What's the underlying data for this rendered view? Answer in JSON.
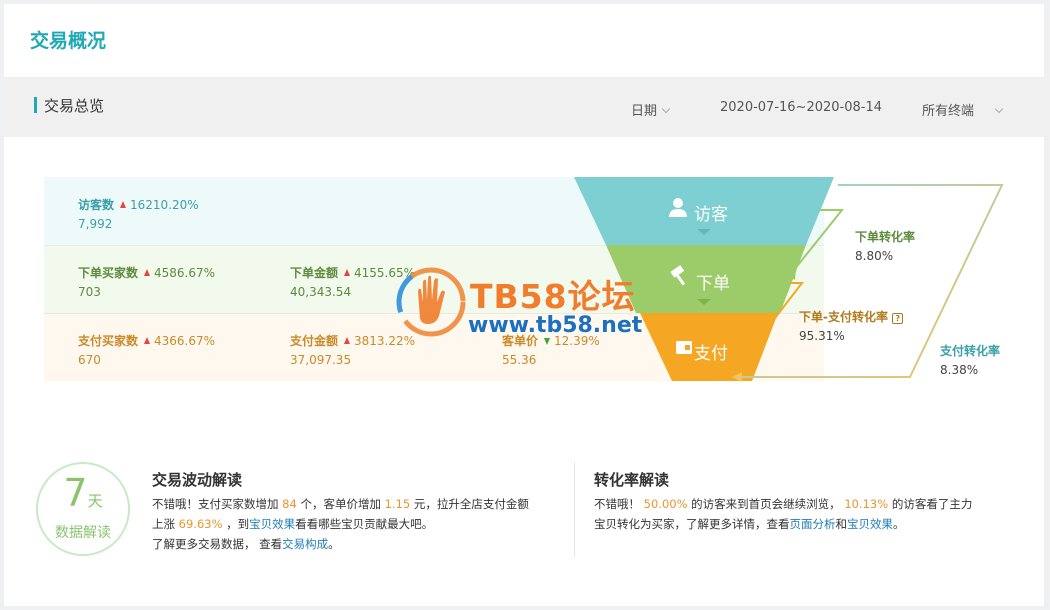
{
  "header": {
    "title": "交易概况"
  },
  "subheader": {
    "title": "交易总览",
    "filters": [
      {
        "label": "日期",
        "has_dropdown": true
      },
      {
        "label": "2020-07-16~2020-08-14",
        "has_dropdown": false
      },
      {
        "label": "所有终端",
        "has_dropdown": true
      }
    ]
  },
  "metrics": {
    "visitors": {
      "label": "访客数",
      "pct": "16210.20%",
      "trend": "up",
      "value": "7,992"
    },
    "order_buyers": {
      "label": "下单买家数",
      "pct": "4586.67%",
      "trend": "up",
      "value": "703"
    },
    "order_amount": {
      "label": "下单金额",
      "pct": "4155.65%",
      "trend": "up",
      "value": "40,343.54"
    },
    "pay_buyers": {
      "label": "支付买家数",
      "pct": "4366.67%",
      "trend": "up",
      "value": "670"
    },
    "pay_amount": {
      "label": "支付金额",
      "pct": "3813.22%",
      "trend": "up",
      "value": "37,097.35"
    },
    "unit_price": {
      "label": "客单价",
      "pct": "12.39%",
      "trend": "down",
      "value": "55.36"
    }
  },
  "funnel": {
    "stages": [
      {
        "label": "访客",
        "icon": "person-icon",
        "color": "#7dcfd2"
      },
      {
        "label": "下单",
        "icon": "gavel-icon",
        "color": "#9ccc6a"
      },
      {
        "label": "支付",
        "icon": "wallet-icon",
        "color": "#f5a623"
      }
    ],
    "conversions": {
      "order_rate": {
        "label": "下单转化率",
        "value": "8.80%",
        "color": "#5f8a3e"
      },
      "order_pay_rate": {
        "label": "下单-支付转化率",
        "value": "95.31%",
        "color": "#b07a1e",
        "help_icon": "question-icon"
      },
      "pay_rate": {
        "label": "支付转化率",
        "value": "8.38%",
        "color": "#3aa0a8"
      }
    }
  },
  "watermark": {
    "title": "TB58论坛",
    "url": "www.tb58.net"
  },
  "insights": {
    "badge": {
      "number": "7",
      "unit": "天",
      "text": "数据解读"
    },
    "trade": {
      "title": "交易波动解读",
      "p1_a": "不错哦！支付买家数增加 ",
      "p1_b": "84",
      "p1_c": " 个，客单价增加 ",
      "p1_d": "1.15",
      "p1_e": " 元，拉升全店支付金额",
      "p2_a": "上涨 ",
      "p2_b": "69.63%",
      "p2_c": " ，到",
      "p2_link": "宝贝效果",
      "p2_d": "看看哪些宝贝贡献最大吧。",
      "p3_a": "了解更多交易数据， 查看",
      "p3_link": "交易构成",
      "p3_b": "。"
    },
    "conversion": {
      "title": "转化率解读",
      "p1_a": "不错哦！ ",
      "p1_b": "50.00%",
      "p1_c": " 的访客来到首页会继续浏览， ",
      "p1_d": "10.13%",
      "p1_e": " 的访客看了主力",
      "p2_a": "宝贝转化为买家，了解更多详情，查看",
      "p2_link1": "页面分析",
      "p2_b": "和",
      "p2_link2": "宝贝效果",
      "p2_c": "。"
    }
  }
}
